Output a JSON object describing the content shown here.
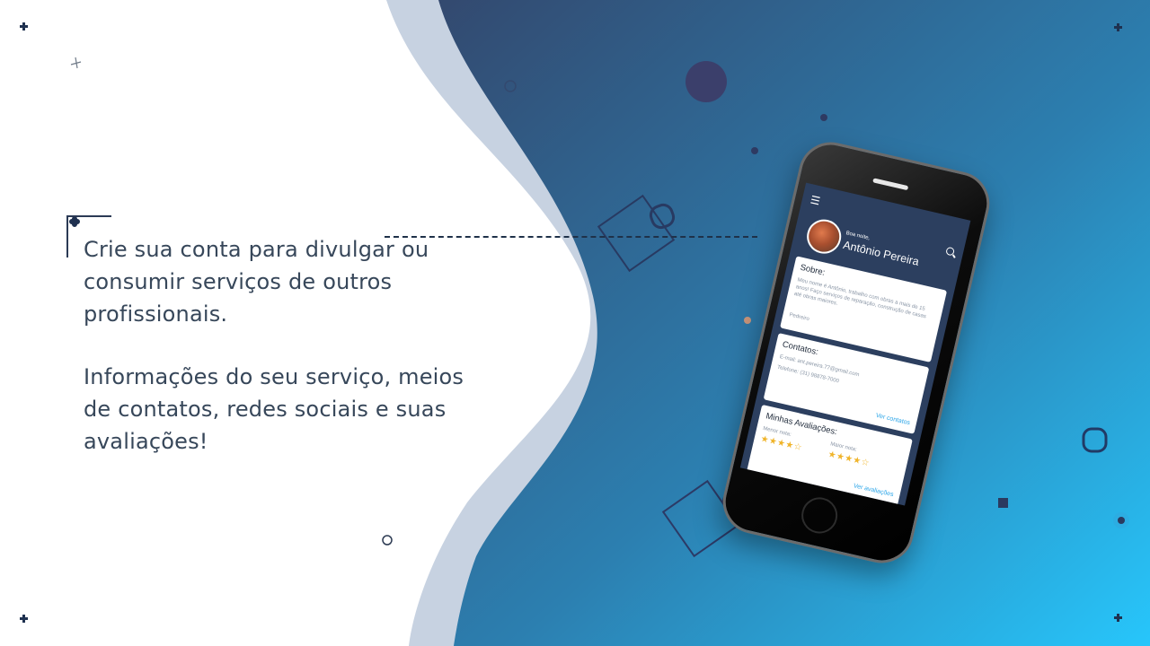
{
  "colors": {
    "gradient_start": "#33496f",
    "gradient_end": "#27c6fb",
    "wave_light": "#c7d1e0",
    "text": "#37475a",
    "accent_link": "#2aa5e8",
    "star": "#f0b429"
  },
  "intro": {
    "paragraph_1": "Crie sua conta para divulgar ou consumir serviços de outros profissionais.",
    "paragraph_2": "Informações do seu serviço, meios de contatos, redes sociais e suas avaliações!"
  },
  "app": {
    "greeting": "Boa noite,",
    "user_name": "Antônio Pereira",
    "menu_icon": "hamburger-icon",
    "search_icon": "search-icon",
    "about": {
      "title": "Sobre:",
      "text": "Meu nome é Antônio, trabalho com obras a mais de 15 anos! Faço serviços de reparação, construção de casas até obras maiores.",
      "profession": "Pedreiro"
    },
    "contacts": {
      "title": "Contatos:",
      "email": "E-mail: ant.pereira.77@gmail.com",
      "phone": "Telefone: (31) 98878-7000",
      "link": "Ver contatos"
    },
    "ratings": {
      "title": "Minhas Avaliações:",
      "lowest_label": "Menor nota:",
      "lowest_stars": "★★★★☆",
      "lowest_value": 4,
      "highest_label": "Maior nota:",
      "highest_stars": "★★★★☆",
      "highest_value": 4,
      "link": "Ver avaliações"
    }
  }
}
